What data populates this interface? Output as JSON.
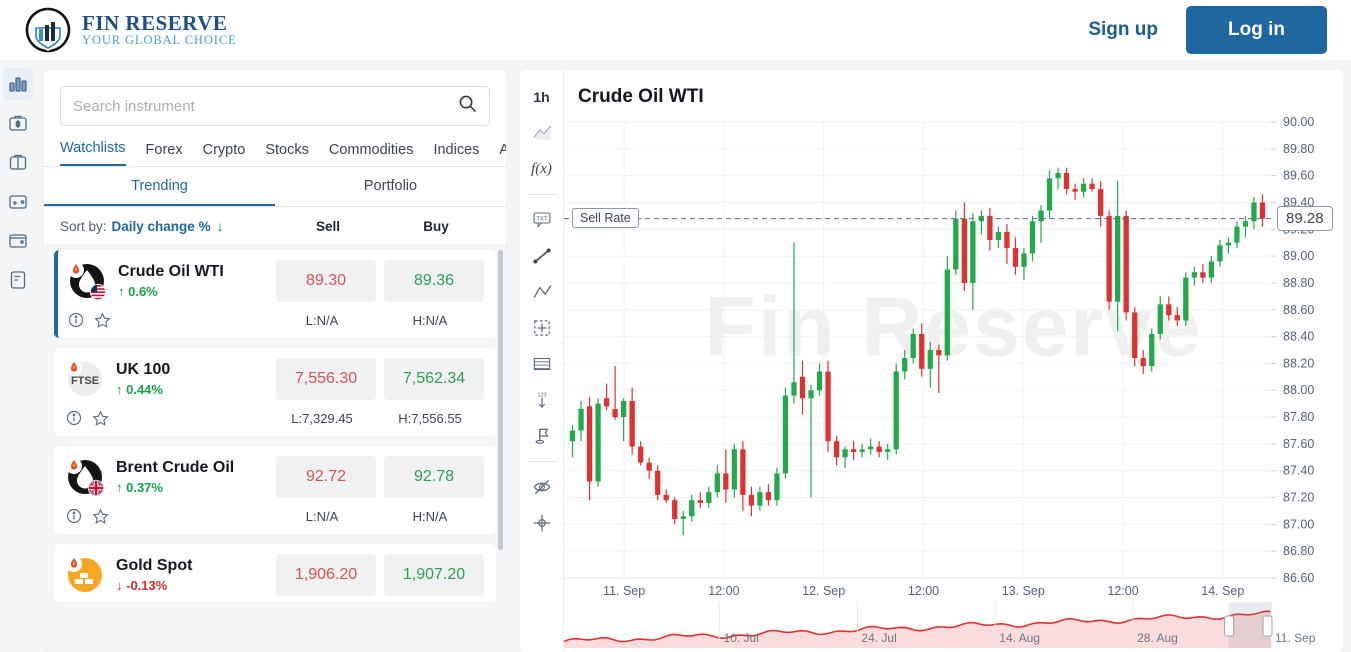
{
  "header": {
    "brand_name": "FIN RESERVE",
    "brand_tagline": "YOUR GLOBAL CHOICE",
    "signup_label": "Sign up",
    "login_label": "Log in",
    "accent_color": "#1f679e"
  },
  "rail": {
    "items": [
      {
        "icon": "bar-chart-icon",
        "active": true
      },
      {
        "icon": "briefcase-dollar-icon",
        "active": false
      },
      {
        "icon": "briefcase-icon",
        "active": false
      },
      {
        "icon": "wallet-add-icon",
        "active": false
      },
      {
        "icon": "wallet-icon",
        "active": false
      },
      {
        "icon": "document-icon",
        "active": false
      }
    ]
  },
  "watchlist": {
    "search": {
      "placeholder": "Search instrument",
      "value": "",
      "icon": "search-icon"
    },
    "tabs": [
      {
        "label": "Watchlists",
        "active": true
      },
      {
        "label": "Forex",
        "active": false
      },
      {
        "label": "Crypto",
        "active": false
      },
      {
        "label": "Stocks",
        "active": false
      },
      {
        "label": "Commodities",
        "active": false
      },
      {
        "label": "Indices",
        "active": false
      },
      {
        "label": "All",
        "active": false
      }
    ],
    "subtabs": [
      {
        "label": "Trending",
        "active": true
      },
      {
        "label": "Portfolio",
        "active": false
      }
    ],
    "sort": {
      "label": "Sort by:",
      "value": "Daily change %",
      "direction_icon": "arrow-down-icon"
    },
    "columns": {
      "sell": "Sell",
      "buy": "Buy"
    },
    "instruments": [
      {
        "name": "Crude Oil WTI",
        "change": "0.6%",
        "direction": "up",
        "sell": "89.30",
        "buy": "89.36",
        "low": "L:N/A",
        "high": "H:N/A",
        "icon": "oil-drop-icon",
        "flag": "us-flag",
        "selected": true
      },
      {
        "name": "UK 100",
        "change": "0.44%",
        "direction": "up",
        "sell": "7,556.30",
        "buy": "7,562.34",
        "low": "L:7,329.45",
        "high": "H:7,556.55",
        "icon": "ftse-icon",
        "flag": "",
        "selected": false
      },
      {
        "name": "Brent Crude Oil",
        "change": "0.37%",
        "direction": "up",
        "sell": "92.72",
        "buy": "92.78",
        "low": "L:N/A",
        "high": "H:N/A",
        "icon": "oil-drop-icon",
        "flag": "uk-flag",
        "selected": false
      },
      {
        "name": "Gold Spot",
        "change": "-0.13%",
        "direction": "down",
        "sell": "1,906.20",
        "buy": "1,907.20",
        "low": "",
        "high": "",
        "icon": "gold-bars-icon",
        "flag": "",
        "selected": false
      }
    ]
  },
  "chart_tools": [
    {
      "name": "timeframe-1h",
      "label": "1h",
      "kind": "text"
    },
    {
      "name": "line-chart-icon",
      "label": "",
      "kind": "icon"
    },
    {
      "name": "indicators-fx-icon",
      "label": "f(x)",
      "kind": "fx"
    },
    {
      "name": "separator",
      "label": "",
      "kind": "sep"
    },
    {
      "name": "text-note-icon",
      "label": "TXT",
      "kind": "txt"
    },
    {
      "name": "trend-line-icon",
      "label": "",
      "kind": "icon"
    },
    {
      "name": "elliott-wave-icon",
      "label": "",
      "kind": "icon"
    },
    {
      "name": "selection-box-icon",
      "label": "",
      "kind": "icon"
    },
    {
      "name": "table-grid-icon",
      "label": "",
      "kind": "icon"
    },
    {
      "name": "measure-arrow-icon",
      "label": "",
      "kind": "icon"
    },
    {
      "name": "flag-marker-icon",
      "label": "",
      "kind": "icon"
    },
    {
      "name": "separator",
      "label": "",
      "kind": "sep"
    },
    {
      "name": "hide-drawings-icon",
      "label": "",
      "kind": "icon"
    },
    {
      "name": "crosshair-icon",
      "label": "",
      "kind": "icon"
    }
  ],
  "chart": {
    "title": "Crude Oil WTI",
    "watermark": "Fin Reserve",
    "sell_rate_label": "Sell Rate",
    "current_price": "89.28",
    "colors": {
      "up": "#23a94b",
      "down": "#e03131",
      "navigator": "#e03131"
    }
  },
  "chart_data": {
    "type": "candlestick",
    "title": "Crude Oil WTI",
    "timeframe": "1h",
    "ylabel": "",
    "xlabel": "",
    "ylim": [
      86.6,
      90.0
    ],
    "ytick_step": 0.2,
    "yticks": [
      "90.00",
      "89.80",
      "89.60",
      "89.40",
      "89.20",
      "89.00",
      "88.80",
      "88.60",
      "88.40",
      "88.20",
      "88.00",
      "87.80",
      "87.60",
      "87.40",
      "87.20",
      "87.00",
      "86.80",
      "86.60"
    ],
    "xticks": [
      "11. Sep",
      "12:00",
      "12. Sep",
      "12:00",
      "13. Sep",
      "12:00",
      "14. Sep"
    ],
    "grid": true,
    "current_price": 89.28,
    "sell_rate_line": 89.28,
    "candles": [
      {
        "o": 87.62,
        "h": 87.74,
        "l": 87.5,
        "c": 87.7
      },
      {
        "o": 87.7,
        "h": 87.92,
        "l": 87.62,
        "c": 87.86
      },
      {
        "o": 87.88,
        "h": 87.95,
        "l": 87.18,
        "c": 87.32
      },
      {
        "o": 87.32,
        "h": 87.94,
        "l": 87.28,
        "c": 87.9
      },
      {
        "o": 87.94,
        "h": 88.05,
        "l": 87.85,
        "c": 87.88
      },
      {
        "o": 87.86,
        "h": 88.18,
        "l": 87.78,
        "c": 87.8
      },
      {
        "o": 87.8,
        "h": 87.94,
        "l": 87.62,
        "c": 87.92
      },
      {
        "o": 87.92,
        "h": 88.02,
        "l": 87.52,
        "c": 87.58
      },
      {
        "o": 87.58,
        "h": 87.62,
        "l": 87.44,
        "c": 87.46
      },
      {
        "o": 87.46,
        "h": 87.5,
        "l": 87.34,
        "c": 87.4
      },
      {
        "o": 87.4,
        "h": 87.44,
        "l": 87.18,
        "c": 87.22
      },
      {
        "o": 87.22,
        "h": 87.26,
        "l": 87.16,
        "c": 87.18
      },
      {
        "o": 87.18,
        "h": 87.2,
        "l": 87.0,
        "c": 87.04
      },
      {
        "o": 87.04,
        "h": 87.1,
        "l": 86.92,
        "c": 87.06
      },
      {
        "o": 87.06,
        "h": 87.22,
        "l": 87.02,
        "c": 87.18
      },
      {
        "o": 87.18,
        "h": 87.24,
        "l": 87.12,
        "c": 87.16
      },
      {
        "o": 87.16,
        "h": 87.28,
        "l": 87.12,
        "c": 87.24
      },
      {
        "o": 87.24,
        "h": 87.44,
        "l": 87.2,
        "c": 87.38
      },
      {
        "o": 87.38,
        "h": 87.56,
        "l": 87.16,
        "c": 87.26
      },
      {
        "o": 87.26,
        "h": 87.6,
        "l": 87.2,
        "c": 87.56
      },
      {
        "o": 87.56,
        "h": 87.62,
        "l": 87.1,
        "c": 87.22
      },
      {
        "o": 87.22,
        "h": 87.28,
        "l": 87.06,
        "c": 87.14
      },
      {
        "o": 87.14,
        "h": 87.28,
        "l": 87.1,
        "c": 87.24
      },
      {
        "o": 87.24,
        "h": 87.3,
        "l": 87.14,
        "c": 87.18
      },
      {
        "o": 87.18,
        "h": 87.42,
        "l": 87.14,
        "c": 87.38
      },
      {
        "o": 87.38,
        "h": 88.02,
        "l": 87.34,
        "c": 87.96
      },
      {
        "o": 87.96,
        "h": 89.1,
        "l": 87.9,
        "c": 88.06
      },
      {
        "o": 88.1,
        "h": 88.22,
        "l": 87.82,
        "c": 87.94
      },
      {
        "o": 87.94,
        "h": 88.04,
        "l": 87.2,
        "c": 88.0
      },
      {
        "o": 88.0,
        "h": 88.2,
        "l": 87.96,
        "c": 88.14
      },
      {
        "o": 88.14,
        "h": 88.22,
        "l": 87.54,
        "c": 87.62
      },
      {
        "o": 87.62,
        "h": 87.66,
        "l": 87.44,
        "c": 87.5
      },
      {
        "o": 87.5,
        "h": 87.58,
        "l": 87.42,
        "c": 87.56
      },
      {
        "o": 87.56,
        "h": 87.62,
        "l": 87.48,
        "c": 87.54
      },
      {
        "o": 87.54,
        "h": 87.6,
        "l": 87.5,
        "c": 87.56
      },
      {
        "o": 87.56,
        "h": 87.64,
        "l": 87.52,
        "c": 87.58
      },
      {
        "o": 87.58,
        "h": 87.62,
        "l": 87.5,
        "c": 87.54
      },
      {
        "o": 87.54,
        "h": 87.6,
        "l": 87.48,
        "c": 87.56
      },
      {
        "o": 87.56,
        "h": 88.2,
        "l": 87.52,
        "c": 88.14
      },
      {
        "o": 88.14,
        "h": 88.3,
        "l": 88.08,
        "c": 88.24
      },
      {
        "o": 88.24,
        "h": 88.46,
        "l": 88.2,
        "c": 88.42
      },
      {
        "o": 88.42,
        "h": 88.5,
        "l": 88.1,
        "c": 88.16
      },
      {
        "o": 88.16,
        "h": 88.36,
        "l": 88.02,
        "c": 88.3
      },
      {
        "o": 88.3,
        "h": 88.34,
        "l": 87.98,
        "c": 88.26
      },
      {
        "o": 88.26,
        "h": 89.0,
        "l": 88.22,
        "c": 88.9
      },
      {
        "o": 88.9,
        "h": 89.34,
        "l": 88.86,
        "c": 89.28
      },
      {
        "o": 89.28,
        "h": 89.4,
        "l": 88.74,
        "c": 88.8
      },
      {
        "o": 88.8,
        "h": 89.32,
        "l": 88.6,
        "c": 89.26
      },
      {
        "o": 89.26,
        "h": 89.34,
        "l": 89.16,
        "c": 89.3
      },
      {
        "o": 89.3,
        "h": 89.36,
        "l": 89.04,
        "c": 89.12
      },
      {
        "o": 89.12,
        "h": 89.22,
        "l": 89.06,
        "c": 89.18
      },
      {
        "o": 89.18,
        "h": 89.24,
        "l": 88.94,
        "c": 89.06
      },
      {
        "o": 89.06,
        "h": 89.14,
        "l": 88.86,
        "c": 88.92
      },
      {
        "o": 88.92,
        "h": 89.06,
        "l": 88.82,
        "c": 89.02
      },
      {
        "o": 89.02,
        "h": 89.3,
        "l": 88.96,
        "c": 89.26
      },
      {
        "o": 89.26,
        "h": 89.38,
        "l": 89.1,
        "c": 89.34
      },
      {
        "o": 89.34,
        "h": 89.64,
        "l": 89.28,
        "c": 89.58
      },
      {
        "o": 89.58,
        "h": 89.66,
        "l": 89.5,
        "c": 89.62
      },
      {
        "o": 89.62,
        "h": 89.66,
        "l": 89.46,
        "c": 89.5
      },
      {
        "o": 89.5,
        "h": 89.54,
        "l": 89.42,
        "c": 89.48
      },
      {
        "o": 89.48,
        "h": 89.58,
        "l": 89.44,
        "c": 89.54
      },
      {
        "o": 89.54,
        "h": 89.58,
        "l": 89.48,
        "c": 89.5
      },
      {
        "o": 89.5,
        "h": 89.56,
        "l": 89.22,
        "c": 89.3
      },
      {
        "o": 89.3,
        "h": 89.34,
        "l": 88.6,
        "c": 88.66
      },
      {
        "o": 88.66,
        "h": 89.56,
        "l": 88.44,
        "c": 89.3
      },
      {
        "o": 89.3,
        "h": 89.34,
        "l": 88.52,
        "c": 88.58
      },
      {
        "o": 88.58,
        "h": 88.62,
        "l": 88.18,
        "c": 88.24
      },
      {
        "o": 88.24,
        "h": 88.3,
        "l": 88.12,
        "c": 88.18
      },
      {
        "o": 88.18,
        "h": 88.46,
        "l": 88.14,
        "c": 88.42
      },
      {
        "o": 88.42,
        "h": 88.7,
        "l": 88.38,
        "c": 88.64
      },
      {
        "o": 88.64,
        "h": 88.7,
        "l": 88.52,
        "c": 88.56
      },
      {
        "o": 88.56,
        "h": 88.62,
        "l": 88.48,
        "c": 88.52
      },
      {
        "o": 88.52,
        "h": 88.88,
        "l": 88.48,
        "c": 88.84
      },
      {
        "o": 88.84,
        "h": 88.92,
        "l": 88.78,
        "c": 88.88
      },
      {
        "o": 88.88,
        "h": 88.94,
        "l": 88.8,
        "c": 88.84
      },
      {
        "o": 88.84,
        "h": 89.0,
        "l": 88.8,
        "c": 88.96
      },
      {
        "o": 88.96,
        "h": 89.12,
        "l": 88.92,
        "c": 89.08
      },
      {
        "o": 89.08,
        "h": 89.14,
        "l": 89.02,
        "c": 89.1
      },
      {
        "o": 89.1,
        "h": 89.26,
        "l": 89.06,
        "c": 89.22
      },
      {
        "o": 89.22,
        "h": 89.3,
        "l": 89.14,
        "c": 89.26
      },
      {
        "o": 89.26,
        "h": 89.44,
        "l": 89.2,
        "c": 89.4
      },
      {
        "o": 89.4,
        "h": 89.46,
        "l": 89.22,
        "c": 89.28
      }
    ],
    "navigator": {
      "xticks": [
        "10. Jul",
        "24. Jul",
        "14. Aug",
        "28. Aug",
        "11. Sep"
      ],
      "series_color": "#e03131",
      "selection_start_pct": 94,
      "selection_end_pct": 100
    }
  }
}
